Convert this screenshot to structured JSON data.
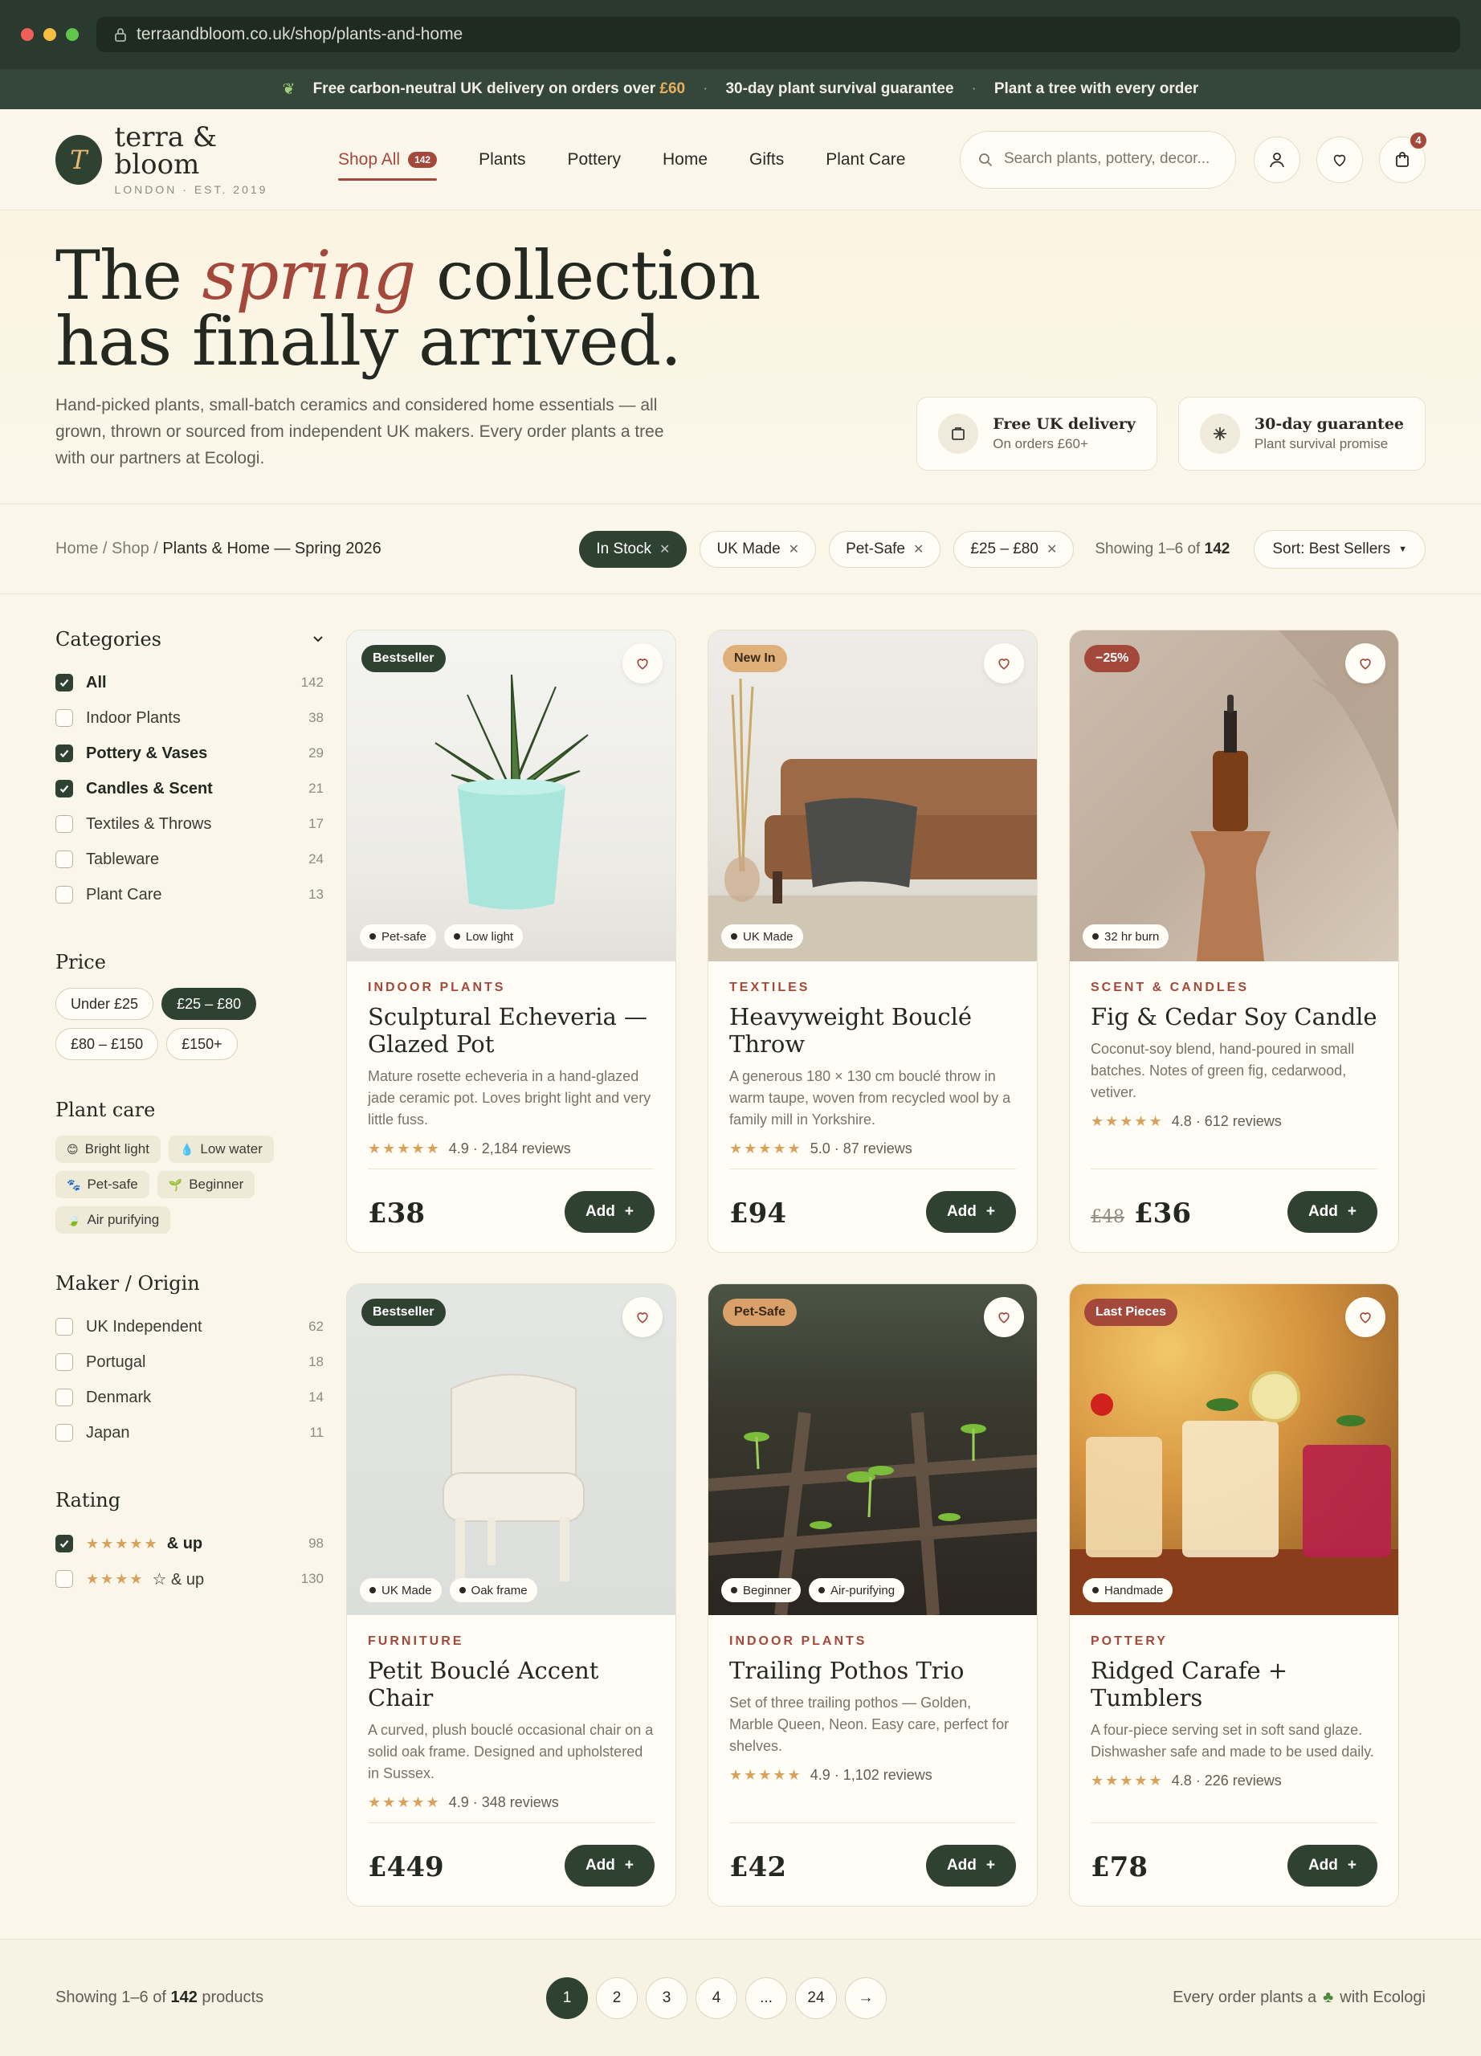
{
  "browser": {
    "url": "terraandbloom.co.uk/shop/plants-and-home"
  },
  "promo": {
    "delivery_prefix": "Free carbon-neutral UK delivery on orders over",
    "delivery_amount": "£60",
    "guarantee": "30-day plant survival guarantee",
    "tree": "Plant a tree with every order"
  },
  "header": {
    "logo_letter": "T",
    "brand": "terra & bloom",
    "tagline": "LONDON · EST. 2019",
    "nav": [
      {
        "label": "Shop All",
        "count": "142"
      },
      {
        "label": "Plants"
      },
      {
        "label": "Pottery"
      },
      {
        "label": "Home"
      },
      {
        "label": "Gifts"
      },
      {
        "label": "Plant Care"
      }
    ],
    "search_placeholder": "Search plants, pottery, decor...",
    "cart_count": "4"
  },
  "hero": {
    "line1_pre": "The",
    "line1_em": "spring",
    "line1_post": "collection",
    "line2": "has finally arrived.",
    "description": "Hand-picked plants, small-batch ceramics and considered home essentials — all grown, thrown or sourced from independent UK makers. Every order plants a tree with our partners at Ecologi.",
    "cards": [
      {
        "title": "Free UK delivery",
        "sub": "On orders £60+"
      },
      {
        "title": "30-day guarantee",
        "sub": "Plant survival promise"
      }
    ]
  },
  "filterbar": {
    "crumb_home": "Home",
    "crumb_shop": "Shop",
    "crumb_current": "Plants & Home — Spring 2026",
    "chips": [
      "In Stock",
      "UK Made",
      "Pet-Safe",
      "£25 – £80"
    ],
    "showing_prefix": "Showing 1–6 of",
    "showing_total": "142",
    "sort": "Sort: Best Sellers"
  },
  "sidebar": {
    "categories_title": "Categories",
    "categories": [
      {
        "label": "All",
        "count": "142"
      },
      {
        "label": "Indoor Plants",
        "count": "38"
      },
      {
        "label": "Pottery & Vases",
        "count": "29"
      },
      {
        "label": "Candles & Scent",
        "count": "21"
      },
      {
        "label": "Textiles & Throws",
        "count": "17"
      },
      {
        "label": "Tableware",
        "count": "24"
      },
      {
        "label": "Plant Care",
        "count": "13"
      }
    ],
    "price_title": "Price",
    "prices": [
      "Under £25",
      "£25 – £80",
      "£80 – £150",
      "£150+"
    ],
    "care_title": "Plant care",
    "care": [
      {
        "icon": "😊",
        "label": "Bright light"
      },
      {
        "icon": "💧",
        "label": "Low water"
      },
      {
        "icon": "🐾",
        "label": "Pet-safe"
      },
      {
        "icon": "🌱",
        "label": "Beginner"
      },
      {
        "icon": "🍃",
        "label": "Air purifying"
      }
    ],
    "maker_title": "Maker / Origin",
    "makers": [
      {
        "label": "UK Independent",
        "count": "62"
      },
      {
        "label": "Portugal",
        "count": "18"
      },
      {
        "label": "Denmark",
        "count": "14"
      },
      {
        "label": "Japan",
        "count": "11"
      }
    ],
    "rating_title": "Rating",
    "ratings": [
      {
        "stars": "★★★★★",
        "label": "& up",
        "count": "98"
      },
      {
        "stars": "★★★★",
        "label": "☆ & up",
        "count": "130"
      }
    ]
  },
  "products": [
    {
      "flag": "Bestseller",
      "tags": [
        "Pet-safe",
        "Low light"
      ],
      "category": "INDOOR PLANTS",
      "name": "Sculptural Echeveria — Glazed Pot",
      "desc": "Mature rosette echeveria in a hand-glazed jade ceramic pot. Loves bright light and very little fuss.",
      "stars": "★★★★★",
      "rating": "4.9 · 2,184 reviews",
      "price": "£38",
      "was": "",
      "add": "Add"
    },
    {
      "flag": "New In",
      "tags": [
        "UK Made"
      ],
      "category": "TEXTILES",
      "name": "Heavyweight Bouclé Throw",
      "desc": "A generous 180 × 130 cm bouclé throw in warm taupe, woven from recycled wool by a family mill in Yorkshire.",
      "stars": "★★★★★",
      "rating": "5.0 · 87 reviews",
      "price": "£94",
      "was": "",
      "add": "Add"
    },
    {
      "flag": "−25%",
      "tags": [
        "32 hr burn"
      ],
      "category": "SCENT & CANDLES",
      "name": "Fig & Cedar Soy Candle",
      "desc": "Coconut-soy blend, hand-poured in small batches. Notes of green fig, cedarwood, vetiver.",
      "stars": "★★★★★",
      "rating": "4.8 · 612 reviews",
      "price": "£36",
      "was": "£48",
      "add": "Add"
    },
    {
      "flag": "Bestseller",
      "tags": [
        "UK Made",
        "Oak frame"
      ],
      "category": "FURNITURE",
      "name": "Petit Bouclé Accent Chair",
      "desc": "A curved, plush bouclé occasional chair on a solid oak frame. Designed and upholstered in Sussex.",
      "stars": "★★★★★",
      "rating": "4.9 · 348 reviews",
      "price": "£449",
      "was": "",
      "add": "Add"
    },
    {
      "flag": "Pet-Safe",
      "tags": [
        "Beginner",
        "Air-purifying"
      ],
      "category": "INDOOR PLANTS",
      "name": "Trailing Pothos Trio",
      "desc": "Set of three trailing pothos — Golden, Marble Queen, Neon. Easy care, perfect for shelves.",
      "stars": "★★★★★",
      "rating": "4.9 · 1,102 reviews",
      "price": "£42",
      "was": "",
      "add": "Add"
    },
    {
      "flag": "Last Pieces",
      "tags": [
        "Handmade"
      ],
      "category": "POTTERY",
      "name": "Ridged Carafe + Tumblers",
      "desc": "A four-piece serving set in soft sand glaze. Dishwasher safe and made to be used daily.",
      "stars": "★★★★★",
      "rating": "4.8 · 226 reviews",
      "price": "£78",
      "was": "",
      "add": "Add"
    }
  ],
  "footer": {
    "showing_prefix": "Showing 1–6 of",
    "total": "142",
    "suffix": "products",
    "pages": [
      "1",
      "2",
      "3",
      "4",
      "...",
      "24",
      "→"
    ],
    "eco_prefix": "Every order plants a",
    "eco_suffix": "with Ecologi"
  },
  "colors": {
    "forest": "#2f4232",
    "terracotta": "#a3483a",
    "cream": "#faf6ea",
    "gold": "#d9a25c"
  }
}
